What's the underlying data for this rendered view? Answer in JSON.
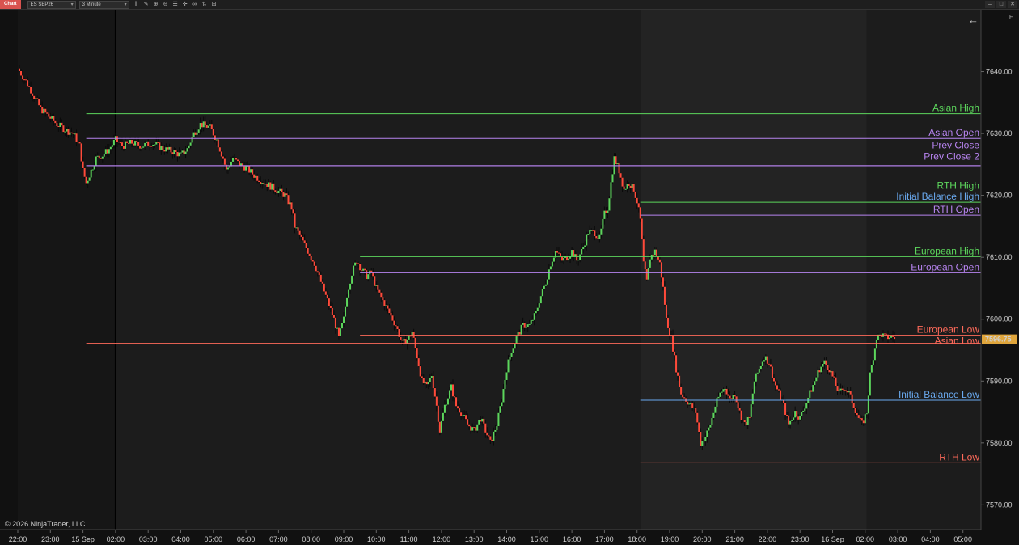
{
  "toolbar": {
    "chart_tab": "Chart",
    "instrument": "ES SEP26",
    "interval": "3 Minute"
  },
  "copyright": "© 2026 NinjaTrader, LLC",
  "colors": {
    "green": "#5cd65c",
    "red": "#ff4a3a",
    "purple": "#b784f0",
    "blue": "#6aaaf0",
    "salmon": "#ff6a5a",
    "price_badge": "#e0a63c"
  },
  "chart_data": {
    "type": "candlestick",
    "ylim": [
      7566,
      7650
    ],
    "y_ticks": [
      {
        "v": 7570,
        "label": "7570.00"
      },
      {
        "v": 7580,
        "label": "7580.00"
      },
      {
        "v": 7590,
        "label": "7590.00"
      },
      {
        "v": 7600,
        "label": "7600.00"
      },
      {
        "v": 7610,
        "label": "7610.00"
      },
      {
        "v": 7620,
        "label": "7620.00"
      },
      {
        "v": 7630,
        "label": "7630.00"
      },
      {
        "v": 7640,
        "label": "7640.00"
      }
    ],
    "x_ticks": [
      "22:00",
      "23:00",
      "15 Sep",
      "02:00",
      "03:00",
      "04:00",
      "05:00",
      "06:00",
      "07:00",
      "08:00",
      "09:00",
      "10:00",
      "11:00",
      "12:00",
      "13:00",
      "14:00",
      "15:00",
      "16:00",
      "17:00",
      "18:00",
      "19:00",
      "20:00",
      "21:00",
      "22:00",
      "23:00",
      "16 Sep",
      "02:00",
      "03:00",
      "04:00",
      "05:00"
    ],
    "x_start": -2,
    "x_end": 28,
    "session_shading": [
      {
        "from": -2,
        "to": 1,
        "color": "#161616"
      },
      {
        "from": 1,
        "to": 17.1,
        "color": "#1c1c1c"
      },
      {
        "from": 17.1,
        "to": 24.05,
        "color": "#232323"
      },
      {
        "from": 24.05,
        "to": 28,
        "color": "#1c1c1c"
      }
    ],
    "session_divider": 1,
    "path": [
      [
        -2.0,
        7640.5
      ],
      [
        -1.7,
        7638
      ],
      [
        -1.5,
        7636
      ],
      [
        -1.3,
        7634
      ],
      [
        -1.0,
        7632.5
      ],
      [
        -0.8,
        7631.5
      ],
      [
        -0.5,
        7630.5
      ],
      [
        -0.3,
        7630
      ],
      [
        -0.1,
        7628
      ],
      [
        0.0,
        7624
      ],
      [
        0.1,
        7622
      ],
      [
        0.25,
        7624
      ],
      [
        0.4,
        7626
      ],
      [
        0.6,
        7626.5
      ],
      [
        0.8,
        7627.5
      ],
      [
        1.0,
        7629
      ],
      [
        1.2,
        7628
      ],
      [
        1.5,
        7628.5
      ],
      [
        1.8,
        7628
      ],
      [
        2.1,
        7628.5
      ],
      [
        2.5,
        7627.5
      ],
      [
        2.8,
        7627
      ],
      [
        3.0,
        7626.5
      ],
      [
        3.2,
        7627.5
      ],
      [
        3.4,
        7630
      ],
      [
        3.6,
        7631.5
      ],
      [
        3.9,
        7631
      ],
      [
        4.1,
        7629
      ],
      [
        4.3,
        7626
      ],
      [
        4.4,
        7624
      ],
      [
        4.6,
        7626
      ],
      [
        4.8,
        7625
      ],
      [
        5.0,
        7624.5
      ],
      [
        5.3,
        7623
      ],
      [
        5.6,
        7622
      ],
      [
        5.9,
        7621
      ],
      [
        6.2,
        7620
      ],
      [
        6.4,
        7618
      ],
      [
        6.5,
        7615
      ],
      [
        6.7,
        7613
      ],
      [
        6.9,
        7611
      ],
      [
        7.1,
        7609
      ],
      [
        7.3,
        7606
      ],
      [
        7.5,
        7603
      ],
      [
        7.7,
        7600
      ],
      [
        7.85,
        7597
      ],
      [
        8.0,
        7600
      ],
      [
        8.1,
        7604
      ],
      [
        8.25,
        7607.5
      ],
      [
        8.4,
        7609.5
      ],
      [
        8.55,
        7608
      ],
      [
        8.7,
        7607
      ],
      [
        8.85,
        7607.5
      ],
      [
        9.0,
        7605
      ],
      [
        9.2,
        7603
      ],
      [
        9.4,
        7601
      ],
      [
        9.6,
        7599
      ],
      [
        9.8,
        7596
      ],
      [
        10.0,
        7597
      ],
      [
        10.1,
        7598
      ],
      [
        10.25,
        7594
      ],
      [
        10.4,
        7590
      ],
      [
        10.55,
        7589
      ],
      [
        10.7,
        7591
      ],
      [
        10.85,
        7586
      ],
      [
        10.95,
        7582
      ],
      [
        11.1,
        7586
      ],
      [
        11.3,
        7589
      ],
      [
        11.45,
        7586
      ],
      [
        11.6,
        7585
      ],
      [
        11.8,
        7583
      ],
      [
        12.0,
        7582
      ],
      [
        12.2,
        7584
      ],
      [
        12.35,
        7582
      ],
      [
        12.5,
        7580
      ],
      [
        12.7,
        7583
      ],
      [
        12.85,
        7587
      ],
      [
        13.0,
        7592
      ],
      [
        13.15,
        7595
      ],
      [
        13.3,
        7597
      ],
      [
        13.5,
        7599
      ],
      [
        13.7,
        7599
      ],
      [
        13.9,
        7601
      ],
      [
        14.0,
        7603
      ],
      [
        14.2,
        7606
      ],
      [
        14.35,
        7609
      ],
      [
        14.5,
        7611
      ],
      [
        14.7,
        7609.5
      ],
      [
        14.85,
        7610
      ],
      [
        15.0,
        7611
      ],
      [
        15.15,
        7609.5
      ],
      [
        15.3,
        7611
      ],
      [
        15.5,
        7614
      ],
      [
        15.7,
        7614
      ],
      [
        15.85,
        7613
      ],
      [
        16.0,
        7617
      ],
      [
        16.1,
        7618
      ],
      [
        16.2,
        7622
      ],
      [
        16.3,
        7626
      ],
      [
        16.45,
        7624
      ],
      [
        16.6,
        7621
      ],
      [
        16.75,
        7622
      ],
      [
        16.9,
        7621
      ],
      [
        17.0,
        7619
      ],
      [
        17.1,
        7616
      ],
      [
        17.2,
        7609
      ],
      [
        17.3,
        7606
      ],
      [
        17.4,
        7610
      ],
      [
        17.55,
        7611
      ],
      [
        17.7,
        7609
      ],
      [
        17.8,
        7605
      ],
      [
        17.9,
        7600
      ],
      [
        18.05,
        7597
      ],
      [
        18.2,
        7592
      ],
      [
        18.35,
        7588
      ],
      [
        18.5,
        7587
      ],
      [
        18.65,
        7586
      ],
      [
        18.8,
        7585
      ],
      [
        18.95,
        7580
      ],
      [
        19.1,
        7581
      ],
      [
        19.25,
        7583
      ],
      [
        19.4,
        7586
      ],
      [
        19.55,
        7588
      ],
      [
        19.7,
        7589
      ],
      [
        19.85,
        7587
      ],
      [
        20.0,
        7588
      ],
      [
        20.15,
        7585
      ],
      [
        20.3,
        7583
      ],
      [
        20.45,
        7584
      ],
      [
        20.6,
        7590
      ],
      [
        20.75,
        7592
      ],
      [
        20.9,
        7594
      ],
      [
        21.05,
        7593
      ],
      [
        21.2,
        7590
      ],
      [
        21.35,
        7588
      ],
      [
        21.5,
        7586
      ],
      [
        21.65,
        7583
      ],
      [
        21.85,
        7585
      ],
      [
        22.0,
        7584
      ],
      [
        22.15,
        7586
      ],
      [
        22.3,
        7588
      ],
      [
        22.45,
        7590
      ],
      [
        22.6,
        7592
      ],
      [
        22.75,
        7593
      ],
      [
        22.9,
        7592
      ],
      [
        23.05,
        7590
      ],
      [
        23.2,
        7588
      ],
      [
        23.35,
        7589
      ],
      [
        23.5,
        7588
      ],
      [
        23.65,
        7586
      ],
      [
        23.8,
        7584
      ],
      [
        23.9,
        7583
      ],
      [
        24.05,
        7585
      ],
      [
        24.15,
        7591
      ],
      [
        24.25,
        7594
      ],
      [
        24.35,
        7597
      ],
      [
        24.5,
        7597.5
      ],
      [
        24.65,
        7597
      ],
      [
        24.8,
        7597.2
      ],
      [
        24.9,
        7597
      ]
    ],
    "level_lines": [
      {
        "label": "Asian High",
        "y": 7633.2,
        "x_from": 0.1,
        "color": "#5cd65c"
      },
      {
        "label": "Asian Open",
        "y": 7629.2,
        "x_from": 0.1,
        "color": "#b784f0"
      },
      {
        "label": "Prev Close",
        "y": 7624.8,
        "x_from": 0.1,
        "color": "#b784f0",
        "label_y": 7627.2
      },
      {
        "label": "Prev Close 2",
        "y": 7624.8,
        "x_from": 0.1,
        "color": "#b784f0",
        "label_y": 7625.4
      },
      {
        "label": "RTH High",
        "y": 7618.9,
        "x_from": 17.1,
        "color": "#5cd65c",
        "label_y": 7620.7
      },
      {
        "label": "Initial Balance High",
        "y": 7618.9,
        "x_from": 17.1,
        "color": "#6aaaf0",
        "label_y": 7618.9,
        "hide_line": true
      },
      {
        "label": "RTH Open",
        "y": 7616.8,
        "x_from": 17.1,
        "color": "#b784f0"
      },
      {
        "label": "European High",
        "y": 7610.1,
        "x_from": 8.5,
        "color": "#5cd65c"
      },
      {
        "label": "European Open",
        "y": 7607.5,
        "x_from": 8.5,
        "color": "#b784f0"
      },
      {
        "label": "European Low",
        "y": 7597.4,
        "x_from": 8.5,
        "color": "#ff6a5a"
      },
      {
        "label": "Asian Low",
        "y": 7596.1,
        "x_from": 0.1,
        "color": "#ff6a5a",
        "label_y": 7595.6
      },
      {
        "label": "Initial Balance Low",
        "y": 7586.9,
        "x_from": 17.1,
        "color": "#6aaaf0"
      },
      {
        "label": "RTH Low",
        "y": 7576.8,
        "x_from": 17.1,
        "color": "#ff6a5a"
      }
    ],
    "last_price": {
      "v": 7596.75,
      "label": "7596.75"
    }
  }
}
